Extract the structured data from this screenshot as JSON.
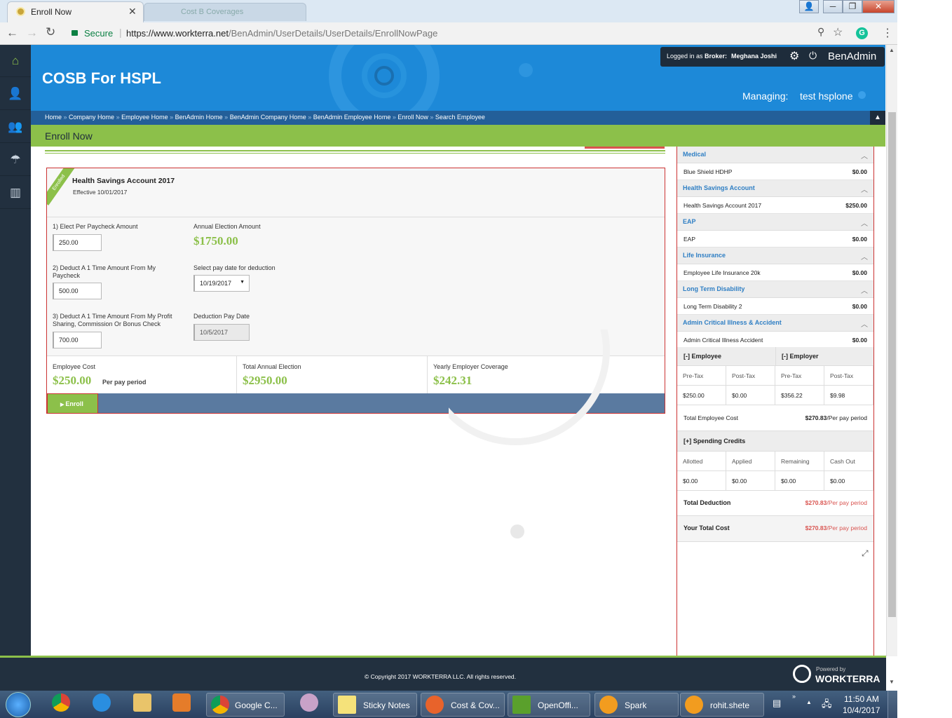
{
  "browser": {
    "active_tab_title": "Enroll Now",
    "inactive_tab_title": "Cost B Coverages",
    "secure_label": "Secure",
    "url_base": "https://www.workterra.net",
    "url_path": "/BenAdmin/UserDetails/UserDetails/EnrollNowPage"
  },
  "app": {
    "company": "COSB For HSPL",
    "logged_in_prefix": "Logged in as",
    "logged_in_role": "Broker:",
    "logged_in_user": "Meghana Joshi",
    "brand": "BenAdmin",
    "managing_label": "Managing:",
    "managing_value": "test hsplone",
    "breadcrumbs": [
      "Home",
      "Company Home",
      "Employee Home",
      "BenAdmin Home",
      "BenAdmin Company Home",
      "BenAdmin Employee Home",
      "Enroll Now",
      "Search Employee"
    ],
    "page_title": "Enroll Now",
    "sidebar_icons": [
      "home-icon",
      "user-icon",
      "users-icon",
      "benefits-icon",
      "reports-icon"
    ]
  },
  "plan": {
    "ribbon": "Enrolled",
    "name": "Health Savings Account 2017",
    "effective": "Effective 10/01/2017",
    "q1_label": "1) Elect Per Paycheck Amount",
    "q1_value": "250.00",
    "annual_label": "Annual Election Amount",
    "annual_value": "$1750.00",
    "q2_label": "2) Deduct A 1 Time Amount From My Paycheck",
    "q2_value": "500.00",
    "paydate_label": "Select pay date for deduction",
    "paydate_value": "10/19/2017",
    "q3_label": "3) Deduct A 1 Time Amount From My Profit Sharing, Commission Or Bonus Check",
    "q3_value": "700.00",
    "deduct_date_label": "Deduction Pay Date",
    "deduct_date_value": "10/5/2017",
    "emp_cost_label": "Employee Cost",
    "emp_cost_value": "$250.00",
    "emp_cost_unit": "Per pay period",
    "total_annual_label": "Total Annual Election",
    "total_annual_value": "$2950.00",
    "yearly_employer_label": "Yearly Employer Coverage",
    "yearly_employer_value": "$242.31",
    "enroll_button": "Enroll"
  },
  "summary": {
    "sections": [
      {
        "title": "Medical",
        "item": "Blue Shield HDHP",
        "amount": "$0.00"
      },
      {
        "title": "Health Savings Account",
        "item": "Health Savings Account 2017",
        "amount": "$250.00"
      },
      {
        "title": "EAP",
        "item": "EAP",
        "amount": "$0.00"
      },
      {
        "title": "Life Insurance",
        "item": "Employee Life Insurance 20k",
        "amount": "$0.00"
      },
      {
        "title": "Long Term Disability",
        "item": "Long Term Disability 2",
        "amount": "$0.00"
      },
      {
        "title": "Admin Critical Illness & Accident",
        "item": "Admin Critical Illness Accident",
        "amount": "$0.00"
      }
    ],
    "employee_header": "[-] Employee",
    "employer_header": "[-] Employer",
    "cost_cols": [
      "Pre-Tax",
      "Post-Tax",
      "Pre-Tax",
      "Post-Tax"
    ],
    "cost_vals": [
      "$250.00",
      "$0.00",
      "$356.22",
      "$9.98"
    ],
    "total_employee_cost_label": "Total Employee Cost",
    "total_employee_cost_value": "$270.83",
    "per_pay_period": "/Per pay period",
    "spending_header": "[+] Spending Credits",
    "spend_cols": [
      "Allotted",
      "Applied",
      "Remaining",
      "Cash Out"
    ],
    "spend_vals": [
      "$0.00",
      "$0.00",
      "$0.00",
      "$0.00"
    ],
    "total_deduction_label": "Total Deduction",
    "total_deduction_value": "$270.83",
    "your_total_label": "Your Total Cost",
    "your_total_value": "$270.83"
  },
  "footer": {
    "copyright": "© Copyright 2017 WORKTERRA LLC. All rights reserved.",
    "powered_by": "Powered by",
    "powered_brand": "WORKTERRA"
  },
  "taskbar": {
    "items": [
      "Google C...",
      "Sticky Notes",
      "Cost & Cov...",
      "OpenOffi...",
      "Spark",
      "rohit.shete"
    ],
    "time": "11:50 AM",
    "date": "10/4/2017"
  }
}
